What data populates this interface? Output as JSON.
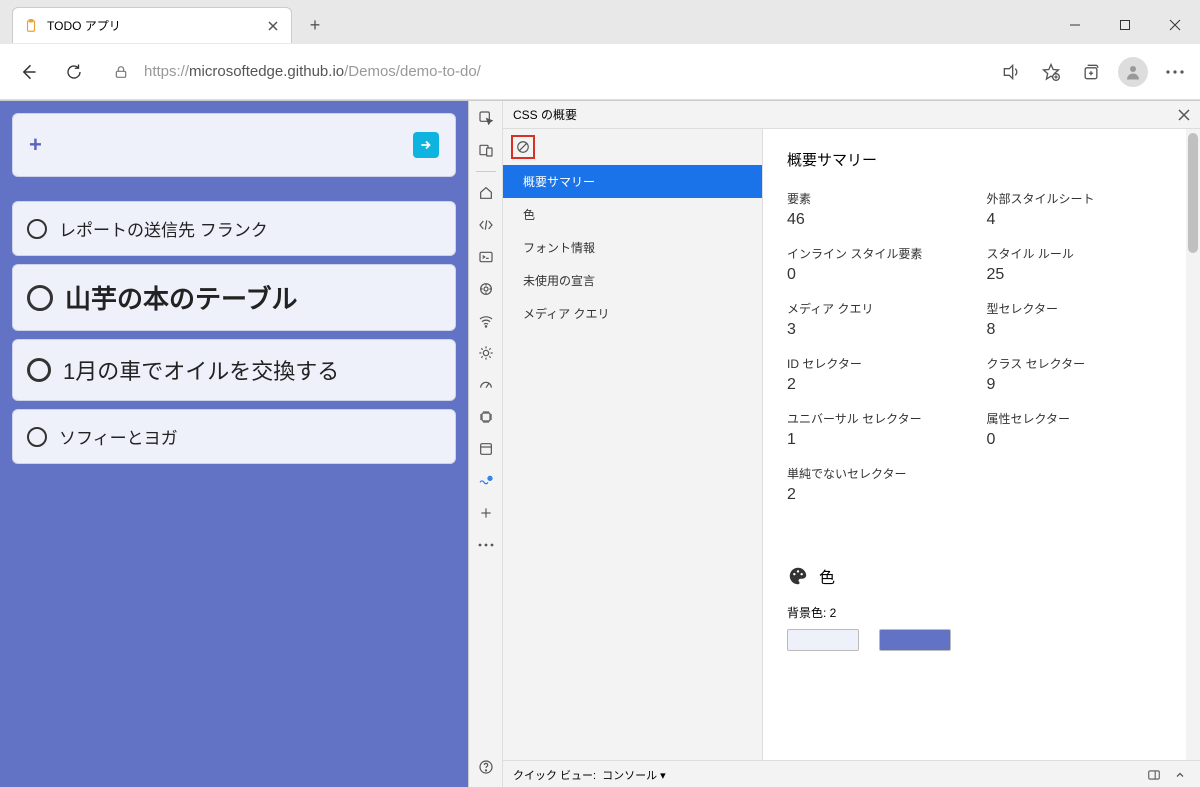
{
  "tab": {
    "title": "TODO アプリ"
  },
  "url": {
    "scheme": "https://",
    "host": "microsoftedge.github.io",
    "path": "/Demos/demo-to-do/"
  },
  "todos": [
    {
      "text": "レポートの送信先 フランク",
      "size": "sm"
    },
    {
      "text": "山芋の本のテーブル",
      "size": "big"
    },
    {
      "text": "1月の車でオイルを交換する",
      "size": "med"
    },
    {
      "text": "ソフィーとヨガ",
      "size": "sm"
    }
  ],
  "devtools": {
    "title": "CSS の概要",
    "nav": [
      "概要サマリー",
      "色",
      "フォント情報",
      "未使用の宣言",
      "メディア クエリ"
    ],
    "summary_heading": "概要サマリー",
    "stats": [
      {
        "label": "要素",
        "value": "46"
      },
      {
        "label": "外部スタイルシート",
        "value": "4"
      },
      {
        "label": "インライン スタイル要素",
        "value": "0"
      },
      {
        "label": "スタイル ルール",
        "value": "25"
      },
      {
        "label": "メディア クエリ",
        "value": "3"
      },
      {
        "label": "型セレクター",
        "value": "8"
      },
      {
        "label": "ID セレクター",
        "value": "2"
      },
      {
        "label": "クラス セレクター",
        "value": "9"
      },
      {
        "label": "ユニバーサル セレクター",
        "value": "1"
      },
      {
        "label": "属性セレクター",
        "value": "0"
      },
      {
        "label": "単純でないセレクター",
        "value": "2"
      }
    ],
    "colors_heading": "色",
    "bg_colors_label": "背景色: 2",
    "bg_colors": [
      "#eef0fa",
      "#6273c6"
    ],
    "quick_view_label": "クイック ビュー:",
    "quick_view_value": "コンソール"
  }
}
